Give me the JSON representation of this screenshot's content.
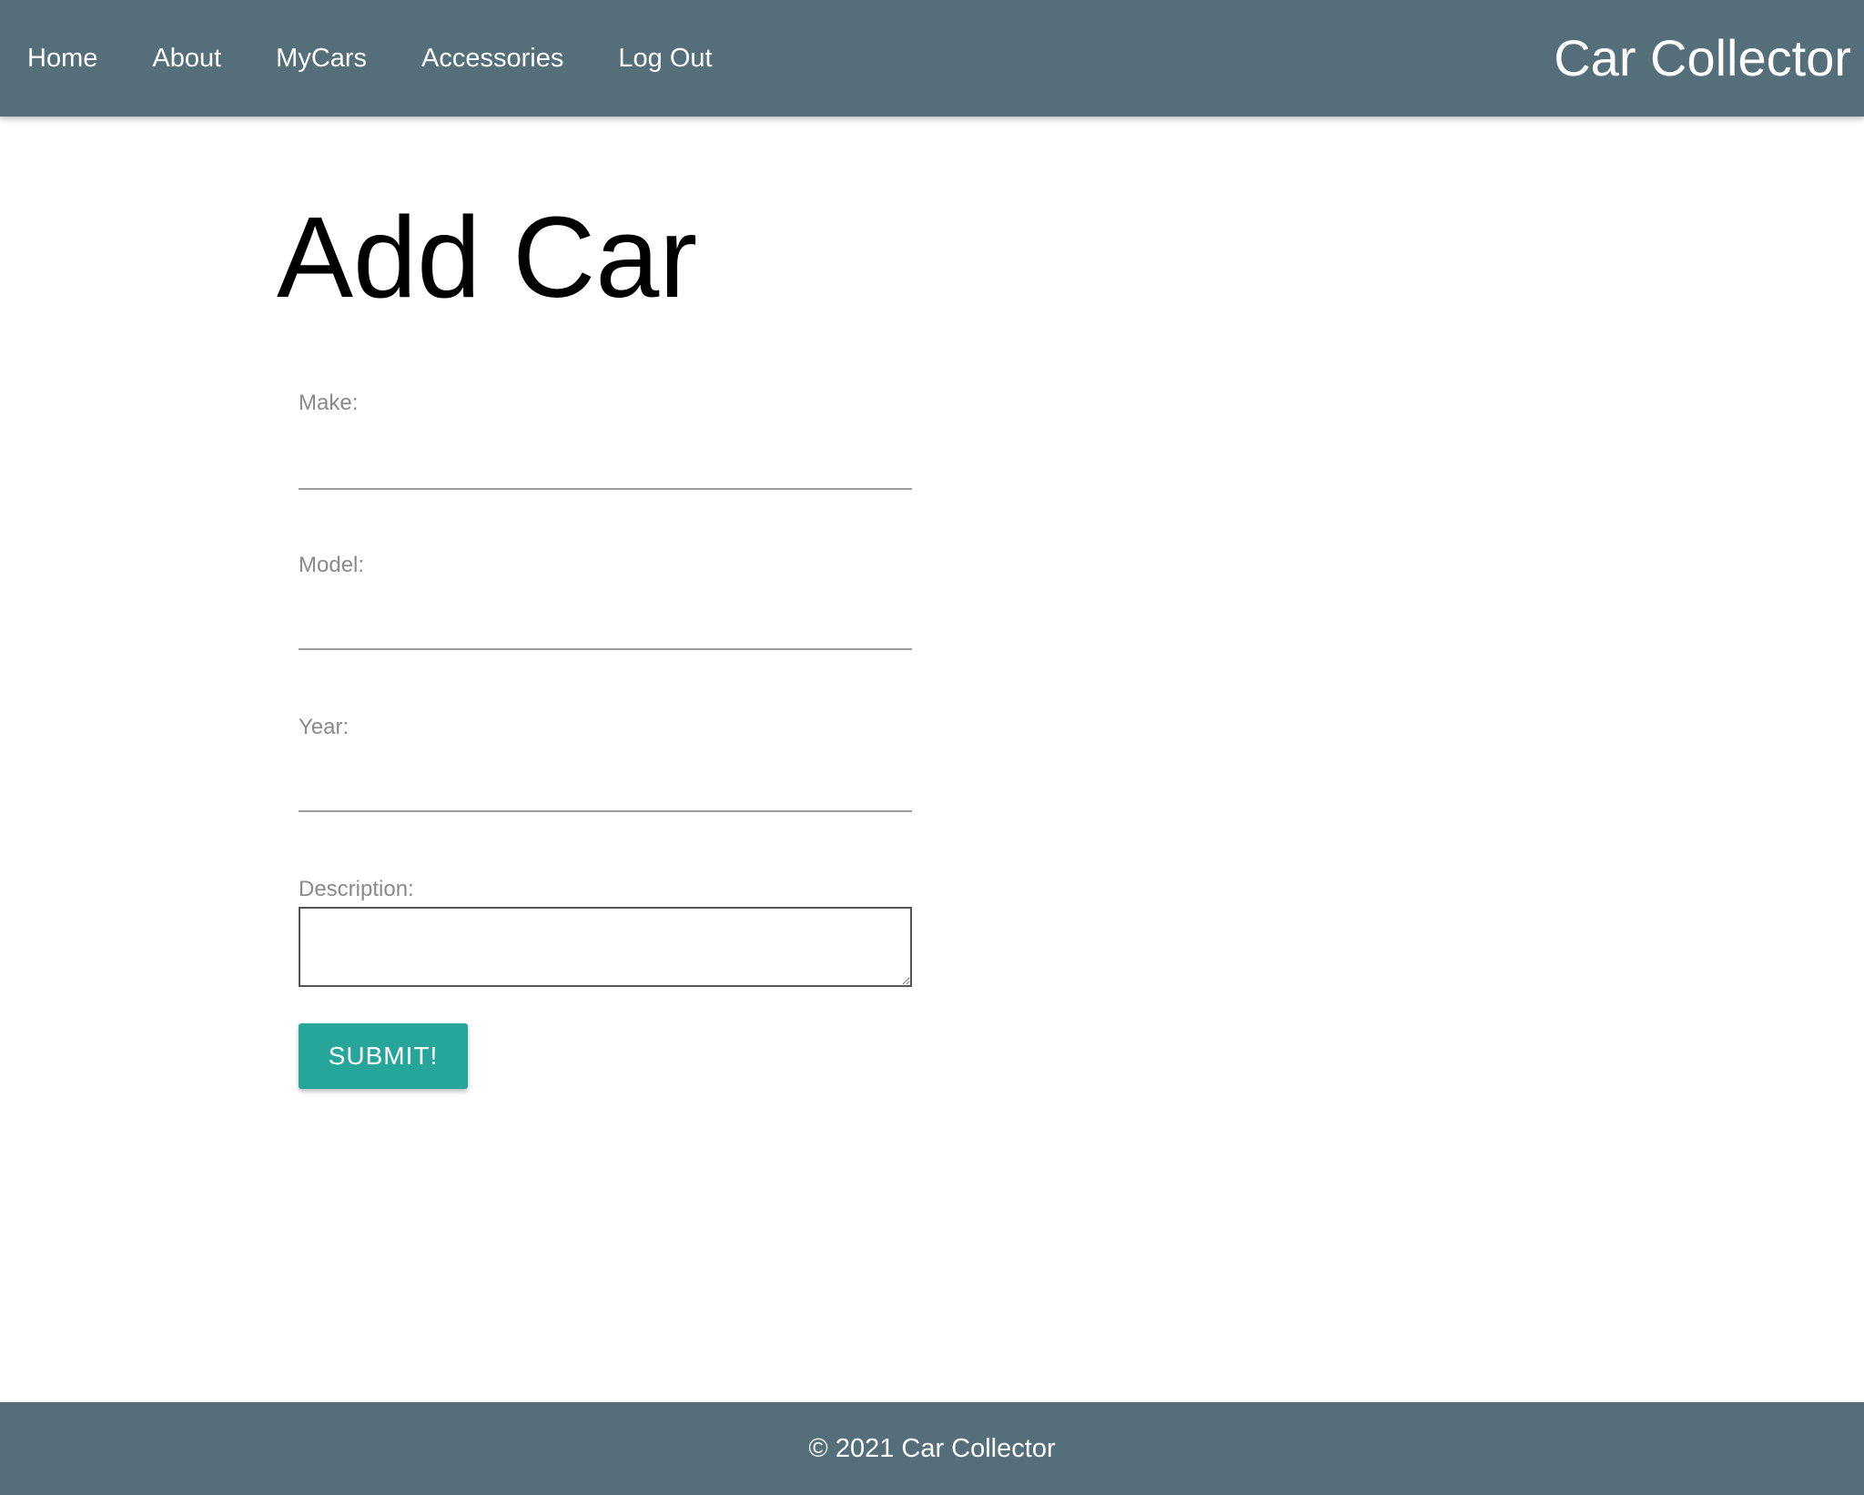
{
  "nav": {
    "links": [
      {
        "label": "Home"
      },
      {
        "label": "About"
      },
      {
        "label": "MyCars"
      },
      {
        "label": "Accessories"
      },
      {
        "label": "Log Out"
      }
    ],
    "brand": "Car Collector"
  },
  "main": {
    "title": "Add Car",
    "form": {
      "make": {
        "label": "Make:",
        "value": ""
      },
      "model": {
        "label": "Model:",
        "value": ""
      },
      "year": {
        "label": "Year:",
        "value": ""
      },
      "description": {
        "label": "Description:",
        "value": ""
      },
      "submit_label": "SUBMIT!"
    }
  },
  "footer": {
    "text": "© 2021 Car Collector"
  },
  "colors": {
    "navbar": "#546e7a",
    "footer": "#546e7a",
    "submit_button": "#26a69a",
    "label_text": "#8a8a8a"
  }
}
